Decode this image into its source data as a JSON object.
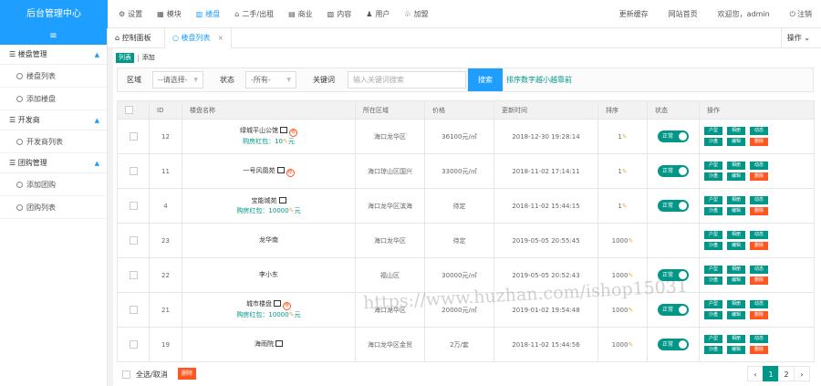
{
  "header": {
    "brand": "后台管理中心",
    "nav": [
      {
        "icon": "gear-icon",
        "glyph": "⚙",
        "label": "设置"
      },
      {
        "icon": "module-icon",
        "glyph": "▦",
        "label": "模块"
      },
      {
        "icon": "building-icon",
        "glyph": "▥",
        "label": "楼盘"
      },
      {
        "icon": "house-icon",
        "glyph": "⌂",
        "label": "二手/出租"
      },
      {
        "icon": "shop-icon",
        "glyph": "▤",
        "label": "商业"
      },
      {
        "icon": "content-icon",
        "glyph": "▧",
        "label": "内容"
      },
      {
        "icon": "user-icon",
        "glyph": "♟",
        "label": "用户"
      },
      {
        "icon": "join-icon",
        "glyph": "♧",
        "label": "加盟"
      }
    ],
    "right": {
      "cache": "更新缓存",
      "home": "网站首页",
      "welcome": "欢迎您，admin",
      "logout": "注销",
      "logout_glyph": "⏻"
    }
  },
  "sidebar": {
    "toggle": "≡",
    "groups": [
      {
        "label": "楼盘管理",
        "items": [
          "楼盘列表",
          "添加楼盘"
        ]
      },
      {
        "label": "开发商",
        "items": [
          "开发商列表"
        ]
      },
      {
        "label": "团购管理",
        "items": [
          "添加团购",
          "团购列表"
        ]
      }
    ]
  },
  "tabs": {
    "home": "控制面板",
    "current": "楼盘列表",
    "close": "×",
    "ops": "操作"
  },
  "subtabs": {
    "list": "列表",
    "add": "添加"
  },
  "filter": {
    "area_label": "区域",
    "area_value": "--请选择-",
    "status_label": "状态",
    "status_value": "-所有-",
    "keyword_label": "关键词",
    "keyword_placeholder": "输入关键词搜索",
    "search": "搜索",
    "tip": "排序数字越小越靠前"
  },
  "table": {
    "headers": [
      "",
      "ID",
      "楼盘名称",
      "所在区域",
      "价格",
      "更新时间",
      "排序",
      "状态",
      "操作"
    ],
    "rows": [
      {
        "id": "12",
        "name": "绿城平山公馆",
        "img": true,
        "zhu": true,
        "bonus": "购房红包：10",
        "area": "海口龙华区",
        "price": "36100元/㎡",
        "time": "2018-12-30 19:28:14",
        "sort": "1",
        "status": "正常"
      },
      {
        "id": "11",
        "name": "一号风凰苑",
        "img": true,
        "zhu": true,
        "bonus": "",
        "area": "海口琼山区国兴",
        "price": "33000元/㎡",
        "time": "2018-11-02 17:14:11",
        "sort": "1",
        "status": "正常"
      },
      {
        "id": "4",
        "name": "宝能城苑",
        "img": true,
        "zhu": false,
        "bonus": "购房红包：10000",
        "area": "海口龙华区滨海",
        "price": "待定",
        "time": "2018-11-02 15:44:15",
        "sort": "1",
        "status": "正常"
      },
      {
        "id": "23",
        "name": "龙华南",
        "img": false,
        "zhu": false,
        "bonus": "",
        "area": "海口龙华区",
        "price": "待定",
        "time": "2019-05-05 20:55:45",
        "sort": "1000",
        "status": ""
      },
      {
        "id": "22",
        "name": "李小东",
        "img": false,
        "zhu": false,
        "bonus": "",
        "area": "福山区",
        "price": "30000元/㎡",
        "time": "2019-05-05 20:52:43",
        "sort": "1000",
        "status": "正常"
      },
      {
        "id": "21",
        "name": "城市楼盘",
        "img": true,
        "zhu": true,
        "bonus": "购房红包：10000",
        "area": "海口龙华区",
        "price": "20000元/㎡",
        "time": "2019-01-02 19:54:48",
        "sort": "1000",
        "status": "正常"
      },
      {
        "id": "19",
        "name": "海雨院",
        "img": true,
        "zhu": false,
        "bonus": "",
        "area": "海口龙华区金贸",
        "price": "2万/套",
        "time": "2018-11-02 15:44:56",
        "sort": "1000",
        "status": "正常"
      }
    ],
    "ops": [
      "户型",
      "相册",
      "动态",
      "沙盘",
      "编辑",
      "删除"
    ],
    "zhu_mark": "荐",
    "bonus_unit": "元"
  },
  "footer": {
    "select_all": "全选/取消",
    "delete": "删除",
    "pages": [
      "‹",
      "1",
      "2",
      "›"
    ]
  },
  "watermark": "https://www.huzhan.com/ishop15031"
}
